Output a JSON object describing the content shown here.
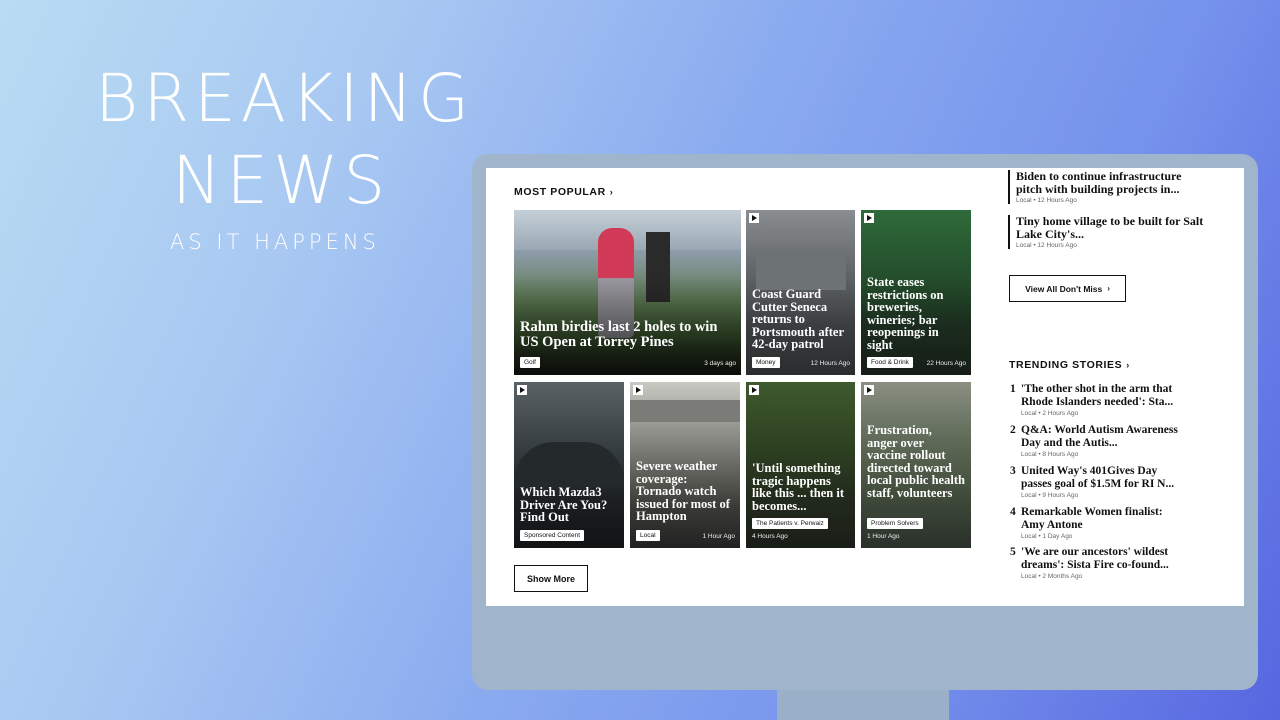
{
  "hero": {
    "line1": "BREAKING",
    "line2": "NEWS",
    "subtitle": "AS IT HAPPENS"
  },
  "most_popular": {
    "title": "MOST POPULAR",
    "cards": [
      {
        "headline": "Rahm birdies last 2 holes to win US Open at Torrey Pines",
        "tag": "Golf",
        "time": "3 days ago"
      },
      {
        "headline": "Coast Guard Cutter Seneca returns to Portsmouth after 42-day patrol",
        "tag": "Money",
        "time": "12 Hours Ago"
      },
      {
        "headline": "State eases restrictions on breweries, wineries; bar reopenings in sight",
        "tag": "Food & Drink",
        "time": "22 Hours Ago"
      },
      {
        "headline": "Which Mazda3 Driver Are You? Find Out",
        "tag": "Sponsored Content",
        "time": ""
      },
      {
        "headline": "Severe weather coverage: Tornado watch issued for most of Hampton",
        "tag": "Local",
        "time": "1 Hour Ago"
      },
      {
        "headline": "'Until something tragic happens like this ... then it becomes...",
        "tag": "The Patients v. Perwaiz",
        "time": "4 Hours Ago"
      },
      {
        "headline": "Frustration, anger over vaccine rollout directed toward local public health staff, volunteers",
        "tag": "Problem Solvers",
        "time": "1 Hour Ago"
      }
    ],
    "show_more": "Show More"
  },
  "dont_miss": {
    "items": [
      {
        "headline": "Biden to continue infrastructure pitch with building projects in...",
        "meta": "Local • 12 Hours Ago"
      },
      {
        "headline": "Tiny home village to be built for Salt Lake City's...",
        "meta": "Local • 12 Hours Ago"
      }
    ],
    "view_all": "View All Don't Miss"
  },
  "trending": {
    "title": "TRENDING STORIES",
    "items": [
      {
        "num": "1",
        "line1": "'The other shot in the arm that",
        "line2": "Rhode Islanders needed': Sta...",
        "meta": "Local • 2 Hours Ago"
      },
      {
        "num": "2",
        "line1": "Q&A: World Autism Awareness",
        "line2": "Day and the Autis...",
        "meta": "Local • 8 Hours Ago"
      },
      {
        "num": "3",
        "line1": "United Way's 401Gives Day",
        "line2": "passes goal of $1.5M for RI N...",
        "meta": "Local • 9 Hours Ago"
      },
      {
        "num": "4",
        "line1": "Remarkable Women finalist:",
        "line2": "Amy Antone",
        "meta": "Local • 1 Day Ago"
      },
      {
        "num": "5",
        "line1": "'We are our ancestors' wildest",
        "line2": "dreams': Sista Fire co-found...",
        "meta": "Local • 2 Months Ago"
      }
    ]
  },
  "colors": {
    "accent": "#111111",
    "monitor": "#a0b5cb"
  },
  "icons": {
    "play": "play-icon",
    "chevron": "chevron-right-icon"
  }
}
